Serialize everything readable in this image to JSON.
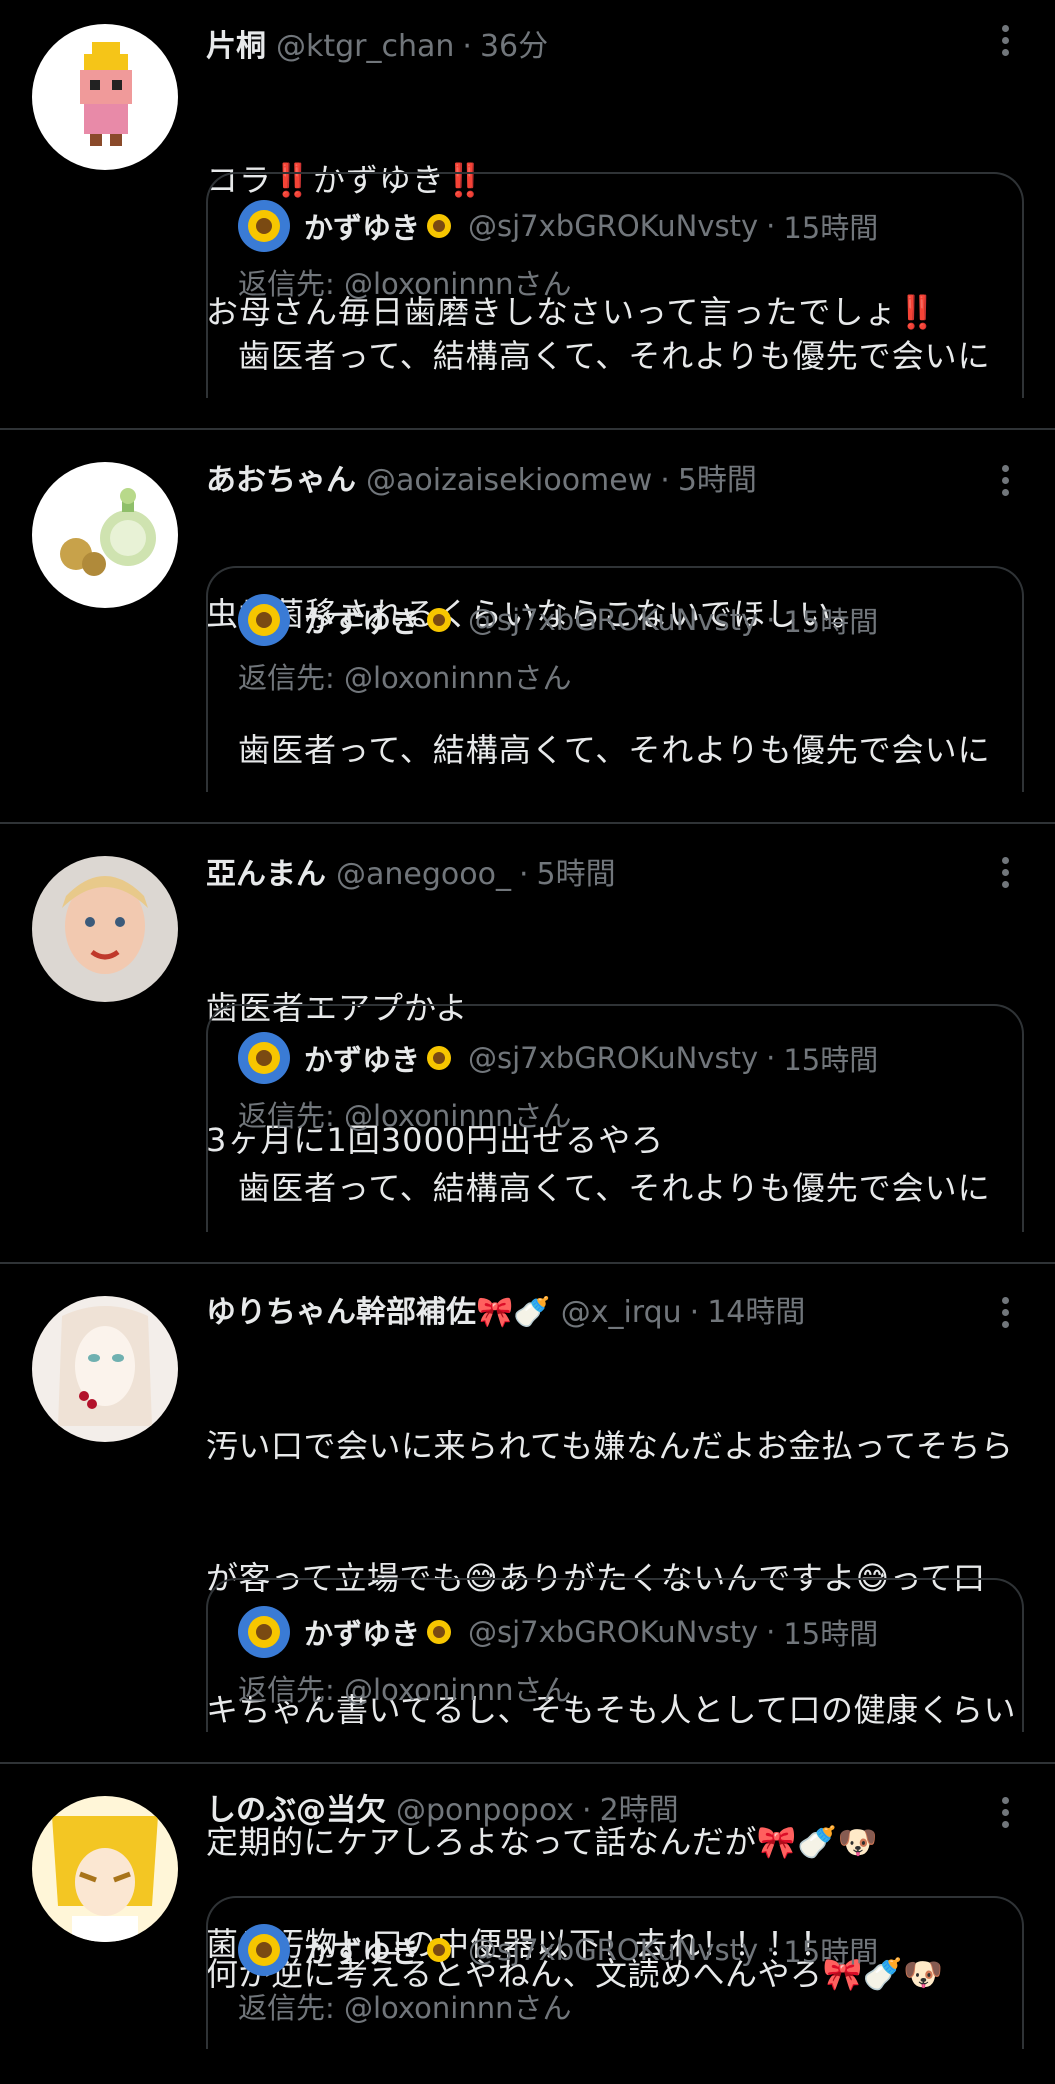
{
  "timeline": {
    "tweets": [
      {
        "name": "片桐",
        "handle": "@ktgr_chan",
        "time": "36分",
        "text_lines": [
          "コラ‼️かずゆき‼️",
          "お母さん毎日歯磨きしなさいって言ったでしょ‼️"
        ]
      },
      {
        "name": "あおちゃん",
        "handle": "@aoizaisekioomew",
        "time": "5時間",
        "text_lines": [
          "虫歯菌移されるくらいならこないでほしい。"
        ]
      },
      {
        "name": "亞んまん",
        "handle": "@anegooo_",
        "time": "5時間",
        "text_lines": [
          "歯医者エアプかよ",
          "3ヶ月に1回3000円出せるやろ"
        ]
      },
      {
        "name": "ゆりちゃん幹部補佐🎀🍼",
        "handle": "@x_irqu",
        "time": "14時間",
        "text_lines": [
          "汚い口で会いに来られても嫌なんだよお金払ってそちら",
          "が客って立場でも😅ありがたくないんですよ😅って口",
          "キちゃん書いてるし、そもそも人として口の健康くらい",
          "定期的にケアしろよなって話なんだが🎀🍼🐶",
          "何が逆に考えるとやねん、文読めへんやろ🎀🍼🐶"
        ]
      },
      {
        "name": "しのぶ@当欠",
        "handle": "@ponpopox",
        "time": "2時間",
        "text_lines": [
          "菌！汚物！口の中便器以下！去れ！！！！"
        ]
      }
    ],
    "quoted": {
      "name": "かずゆき",
      "sun_emoji": "🌻",
      "handle": "@sj7xbGROKuNvsty",
      "time": "15時間",
      "reply_to": "返信先: @loxoninnnさん",
      "text": "歯医者って、結構高くて、それよりも優先で会いに"
    },
    "separator": "·"
  },
  "colors": {
    "background": "#000000",
    "primary_text": "#e7e9ea",
    "secondary_text": "#71767b",
    "border": "#2f3336"
  }
}
